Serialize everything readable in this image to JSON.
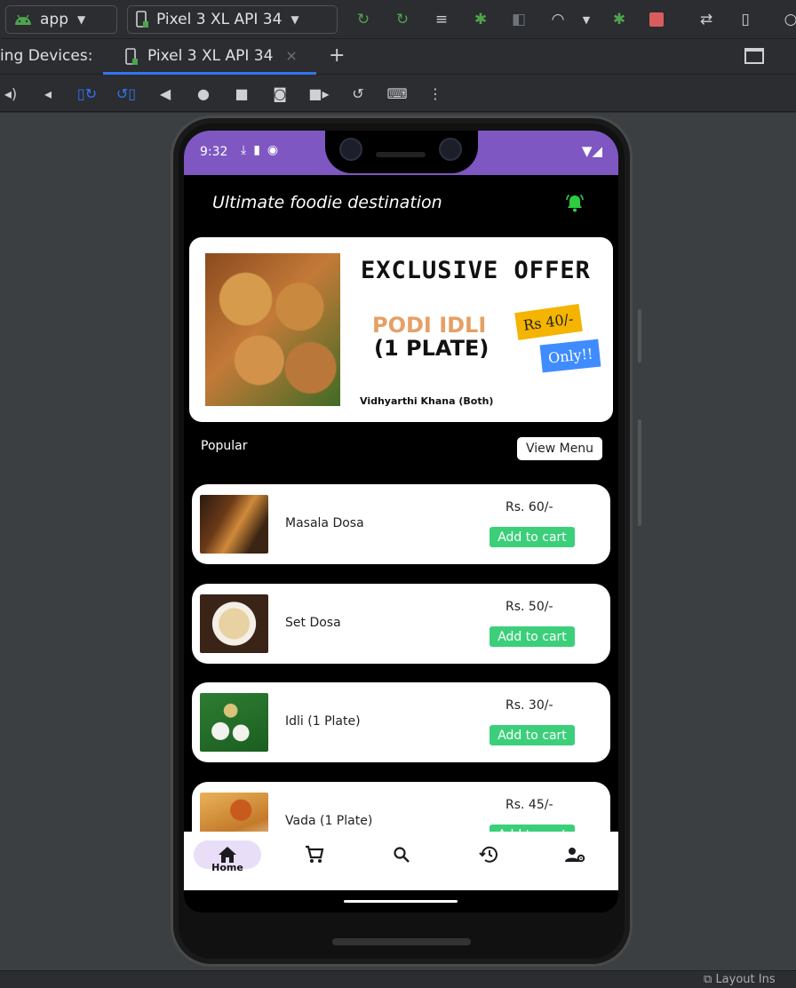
{
  "toolbar": {
    "run_config": "app",
    "device_select": "Pixel 3 XL API 34",
    "icons": [
      "apply-changes-icon",
      "apply-code-changes-icon",
      "logcat-icon",
      "debug-icon",
      "attach-debugger-icon",
      "profiler-icon",
      "attach-icon",
      "stop-icon",
      "sync-icon",
      "device-manager-icon",
      "search-icon"
    ],
    "colors": {
      "green": "#4ea44e",
      "red": "#db5c5c"
    }
  },
  "running_devices": {
    "title": "ing Devices:",
    "tab_label": "Pixel 3 XL API 34",
    "close_symbol": "×",
    "add_symbol": "+"
  },
  "emulator_controls": [
    "volume-up-icon",
    "volume-down-icon",
    "rotate-left-icon",
    "rotate-right-icon",
    "back-icon",
    "home-icon",
    "overview-icon",
    "screenshot-icon",
    "screen-record-icon",
    "snapshot-icon",
    "keyboard-icon",
    "more-icon"
  ],
  "status_bar": {
    "right_text": "Layout Ins"
  },
  "phone": {
    "status": {
      "time": "9:32",
      "left_icons": [
        "download-icon",
        "sd-card-icon",
        "app-icon"
      ],
      "right_icons": [
        "wifi-icon",
        "signal-icon"
      ],
      "bar_color": "#7e57c2"
    },
    "app_title": "Ultimate foodie destination",
    "banner": {
      "heading": "EXCLUSIVE OFFER",
      "dish": "PODI IDLI",
      "quantity": "(1 PLATE)",
      "price_tag": "Rs 40/-",
      "only_tag": "Only!!",
      "vendor": "Vidhyarthi Khana (Both)"
    },
    "section": {
      "label": "Popular",
      "view_menu": "View Menu"
    },
    "menu_items": [
      {
        "name": "Masala Dosa",
        "price": "Rs. 60/-",
        "button": "Add to cart"
      },
      {
        "name": "Set Dosa",
        "price": "Rs. 50/-",
        "button": "Add to cart"
      },
      {
        "name": "Idli (1 Plate)",
        "price": "Rs. 30/-",
        "button": "Add to cart"
      },
      {
        "name": "Vada (1 Plate)",
        "price": "Rs. 45/-",
        "button": "Add to cart"
      }
    ],
    "bottom_nav": [
      {
        "icon": "home-icon",
        "label": "Home",
        "active": true
      },
      {
        "icon": "cart-icon",
        "label": "",
        "active": false
      },
      {
        "icon": "search-icon",
        "label": "",
        "active": false
      },
      {
        "icon": "history-icon",
        "label": "",
        "active": false
      },
      {
        "icon": "account-settings-icon",
        "label": "",
        "active": false
      }
    ],
    "accent": {
      "add_to_cart": "#3ccf7a",
      "nav_pill": "#e8def8",
      "bell": "#2ecc40"
    }
  }
}
